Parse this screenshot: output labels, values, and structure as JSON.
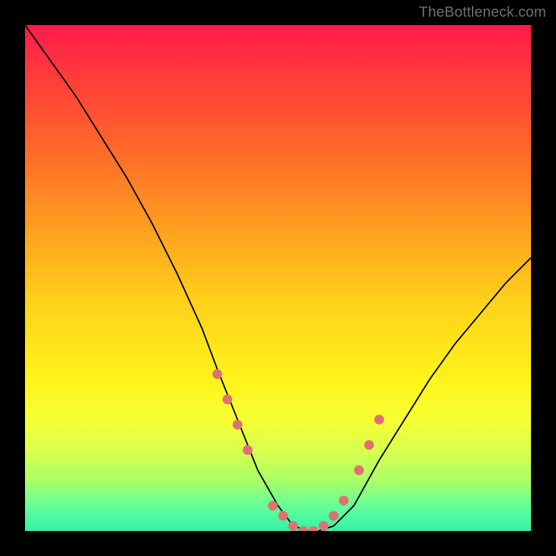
{
  "watermark": "TheBottleneck.com",
  "chart_data": {
    "type": "line",
    "title": "",
    "xlabel": "",
    "ylabel": "",
    "xlim": [
      0,
      100
    ],
    "ylim": [
      0,
      100
    ],
    "series": [
      {
        "name": "curve",
        "x": [
          0,
          5,
          10,
          15,
          20,
          25,
          30,
          35,
          38,
          42,
          46,
          50,
          53,
          56,
          58,
          61,
          65,
          70,
          75,
          80,
          85,
          90,
          95,
          100
        ],
        "y": [
          100,
          93,
          86,
          78,
          70,
          61,
          51,
          40,
          32,
          22,
          12,
          5,
          1,
          0,
          0,
          1,
          5,
          14,
          22,
          30,
          37,
          43,
          49,
          54
        ]
      }
    ],
    "markers": {
      "name": "highlight-points",
      "color": "#e17070",
      "x": [
        38,
        40,
        42,
        44,
        49,
        51,
        53,
        55,
        57,
        59,
        61,
        63,
        66,
        68,
        70
      ],
      "y": [
        31,
        26,
        21,
        16,
        5,
        3,
        1,
        0,
        0,
        1,
        3,
        6,
        12,
        17,
        22
      ]
    },
    "background_gradient": {
      "top": "#ff1a4d",
      "bottom": "#33f0a8"
    }
  }
}
